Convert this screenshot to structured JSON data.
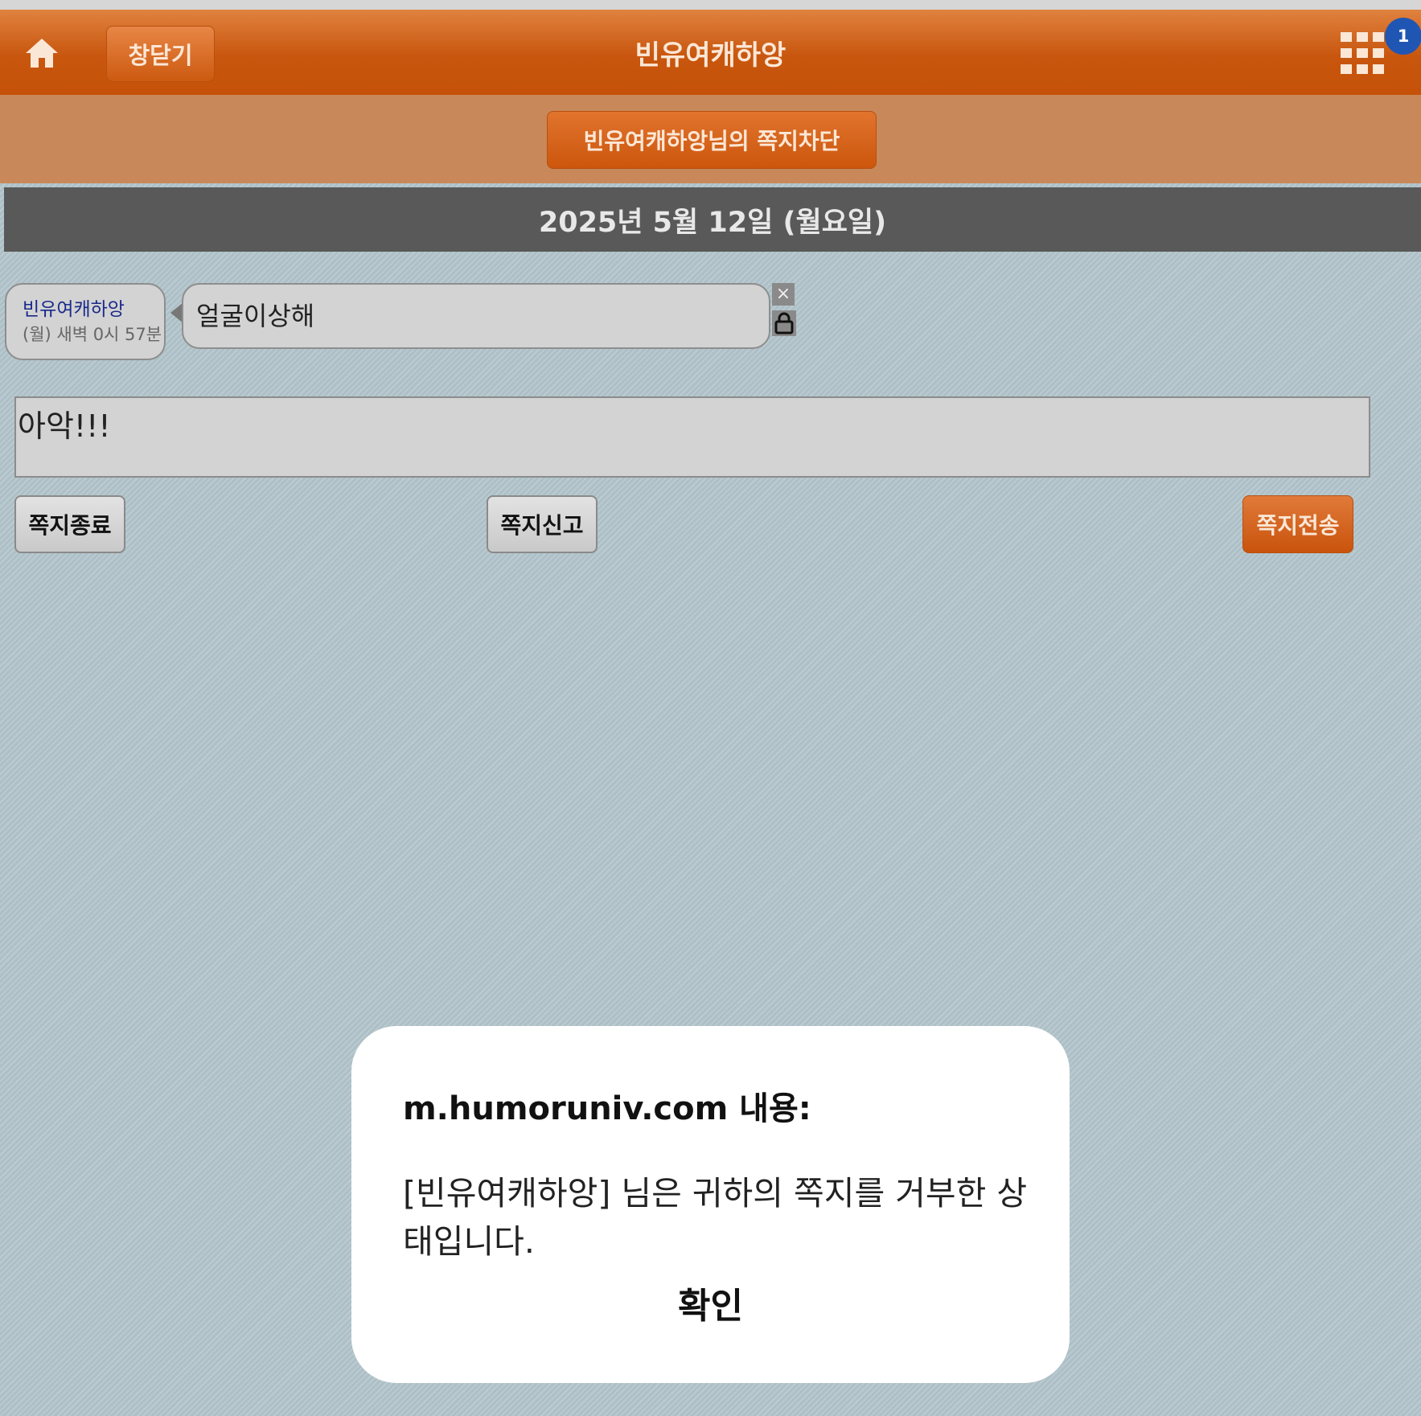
{
  "header": {
    "close_label": "창닫기",
    "title": "빈유여캐하앙",
    "notification_count": "1",
    "colors": {
      "bar": "#c8560e",
      "badge": "#1f56b3"
    }
  },
  "subheader": {
    "block_label": "빈유여캐하앙님의 쪽지차단"
  },
  "conversation": {
    "date": "2025년 5월 12일 (월요일)",
    "messages": [
      {
        "sender": "빈유여캐하앙",
        "time": "(월) 새벽 0시 57분",
        "text": "얼굴이상해",
        "delete_icon": "close-icon",
        "lock_icon": "lock-icon"
      }
    ]
  },
  "compose": {
    "value": "아악!!!"
  },
  "actions": {
    "end_label": "쪽지종료",
    "report_label": "쪽지신고",
    "send_label": "쪽지전송"
  },
  "alert": {
    "title": "m.humoruniv.com 내용:",
    "message": "[빈유여캐하앙] 님은 귀하의 쪽지를 거부한 상태입니다.",
    "ok_label": "확인"
  }
}
